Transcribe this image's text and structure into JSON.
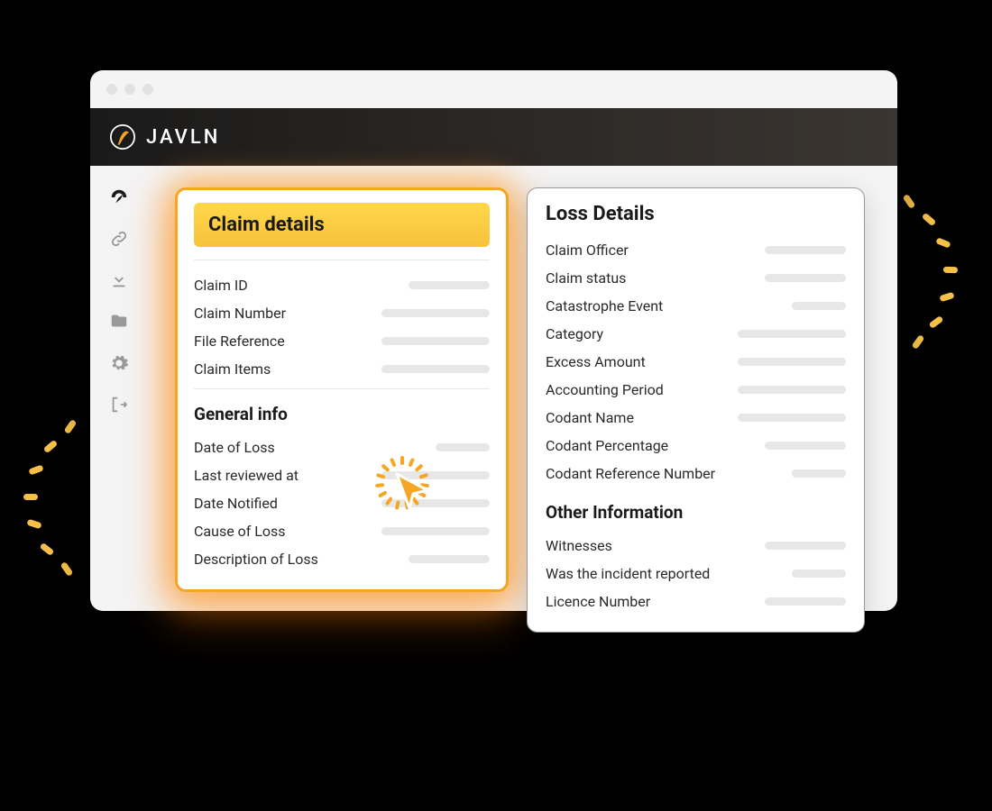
{
  "brand": {
    "name": "JAVLN"
  },
  "sidebar": {
    "items": [
      {
        "name": "dashboard",
        "active": true
      },
      {
        "name": "link"
      },
      {
        "name": "download"
      },
      {
        "name": "folder"
      },
      {
        "name": "settings"
      },
      {
        "name": "logout"
      }
    ]
  },
  "claim_card": {
    "title": "Claim details",
    "fields": [
      {
        "label": "Claim ID"
      },
      {
        "label": "Claim Number"
      },
      {
        "label": "File Reference"
      },
      {
        "label": "Claim Items"
      }
    ],
    "section2_title": "General info",
    "general_fields": [
      {
        "label": "Date of Loss"
      },
      {
        "label": "Last reviewed at"
      },
      {
        "label": "Date Notified"
      },
      {
        "label": "Cause of Loss"
      },
      {
        "label": "Description of Loss"
      }
    ]
  },
  "loss_card": {
    "title": "Loss Details",
    "fields": [
      {
        "label": "Claim Officer"
      },
      {
        "label": "Claim status"
      },
      {
        "label": "Catastrophe Event"
      },
      {
        "label": "Category"
      },
      {
        "label": "Excess Amount"
      },
      {
        "label": "Accounting Period"
      },
      {
        "label": "Codant Name"
      },
      {
        "label": "Codant Percentage"
      },
      {
        "label": "Codant Reference Number"
      }
    ],
    "section2_title": "Other Information",
    "other_fields": [
      {
        "label": "Witnesses"
      },
      {
        "label": "Was the incident reported"
      },
      {
        "label": "Licence Number"
      }
    ]
  },
  "colors": {
    "accent": "#f5a623",
    "accent_light": "#ffd84a",
    "panel_bg": "#f4f4f4"
  }
}
